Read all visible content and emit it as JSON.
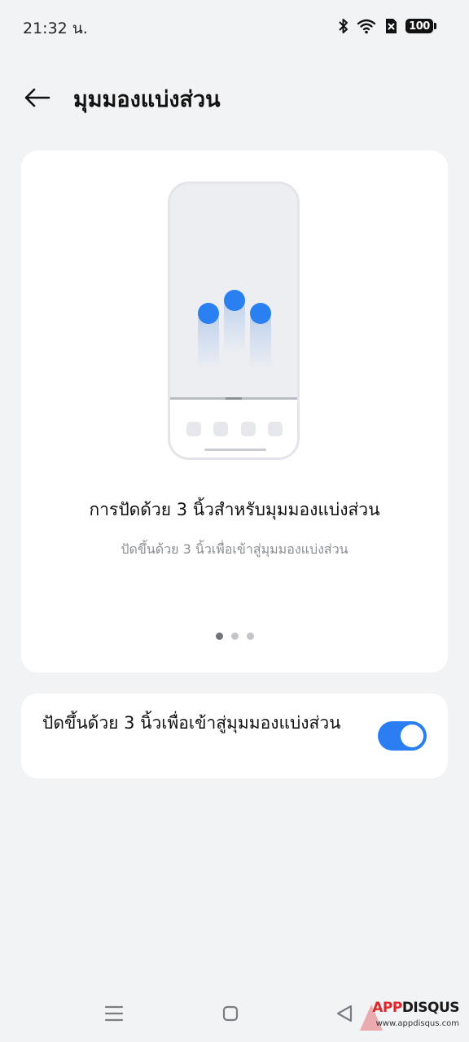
{
  "status_bar": {
    "time": "21:32 น.",
    "battery_level": "100",
    "icons": [
      "bluetooth-icon",
      "wifi-icon",
      "sim-off-icon",
      "battery-icon"
    ]
  },
  "header": {
    "back_icon": "arrow-left-icon",
    "title": "มุมมองแบ่งส่วน"
  },
  "illustration_card": {
    "headline": "การปัดด้วย 3 นิ้วสำหรับมุมมองแบ่งส่วน",
    "subtext": "ปัดขึ้นด้วย 3 นิ้วเพื่อเข้าสู่มุมมองแบ่งส่วน",
    "pager": {
      "total": 3,
      "active_index": 0
    }
  },
  "setting": {
    "label": "ปัดขึ้นด้วย 3 นิ้วเพื่อเข้าสู่มุมมองแบ่งส่วน",
    "enabled": true
  },
  "nav_bar": {
    "icons": [
      "menu-icon",
      "home-icon",
      "back-triangle-icon"
    ]
  },
  "watermark": {
    "brand_app": "APP",
    "brand_disqus": "DISQUS",
    "url": "www.appdisqus.com"
  },
  "colors": {
    "accent": "#2a7ef1",
    "background": "#f2f3f5",
    "card": "#ffffff"
  }
}
